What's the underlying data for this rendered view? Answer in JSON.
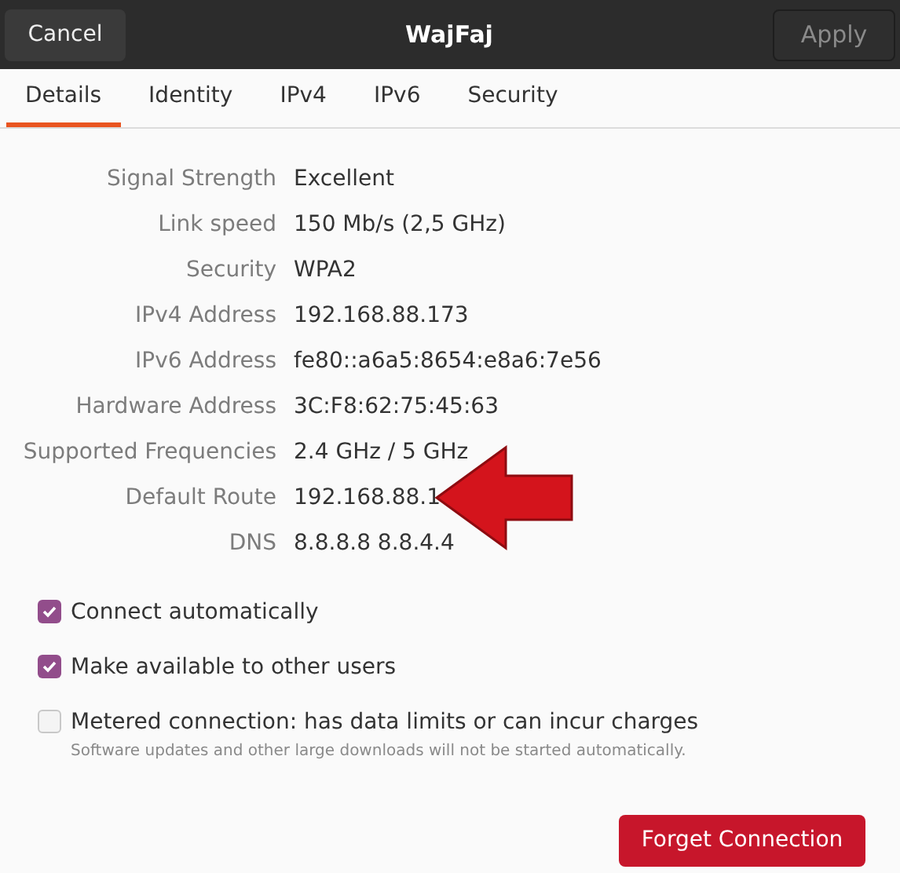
{
  "header": {
    "cancel": "Cancel",
    "title": "WajFaj",
    "apply": "Apply",
    "apply_disabled": true
  },
  "tabs": [
    {
      "label": "Details",
      "selected": true
    },
    {
      "label": "Identity",
      "selected": false
    },
    {
      "label": "IPv4",
      "selected": false
    },
    {
      "label": "IPv6",
      "selected": false
    },
    {
      "label": "Security",
      "selected": false
    }
  ],
  "details": [
    {
      "label": "Signal Strength",
      "value": "Excellent"
    },
    {
      "label": "Link speed",
      "value": "150 Mb/s (2,5 GHz)"
    },
    {
      "label": "Security",
      "value": "WPA2"
    },
    {
      "label": "IPv4 Address",
      "value": "192.168.88.173"
    },
    {
      "label": "IPv6 Address",
      "value": "fe80::a6a5:8654:e8a6:7e56"
    },
    {
      "label": "Hardware Address",
      "value": "3C:F8:62:75:45:63"
    },
    {
      "label": "Supported Frequencies",
      "value": "2.4 GHz / 5 GHz"
    },
    {
      "label": "Default Route",
      "value": "192.168.88.1"
    },
    {
      "label": "DNS",
      "value": "8.8.8.8 8.8.4.4"
    }
  ],
  "options": [
    {
      "label": "Connect automatically",
      "checked": true
    },
    {
      "label": "Make available to other users",
      "checked": true
    },
    {
      "label": "Metered connection: has data limits or can incur charges",
      "hint": "Software updates and other large downloads will not be started automatically.",
      "checked": false
    }
  ],
  "forget_button": "Forget Connection"
}
